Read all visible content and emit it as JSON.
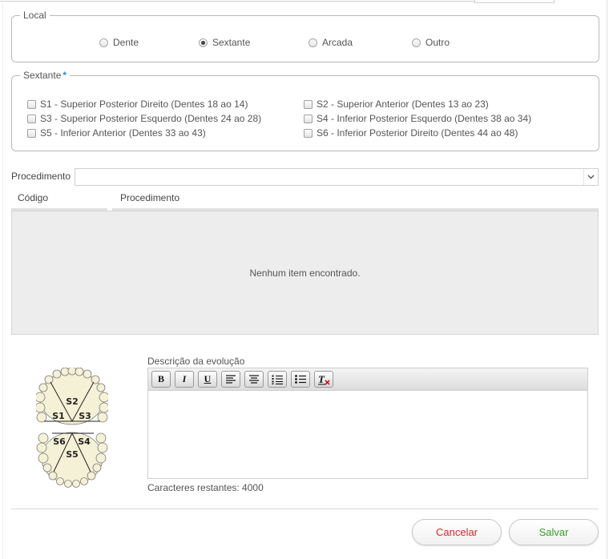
{
  "local": {
    "legend": "Local",
    "options": [
      {
        "label": "Dente",
        "selected": false
      },
      {
        "label": "Sextante",
        "selected": true
      },
      {
        "label": "Arcada",
        "selected": false
      },
      {
        "label": "Outro",
        "selected": false
      }
    ]
  },
  "sextante": {
    "legend": "Sextante",
    "required_mark": "*",
    "options": [
      {
        "label": "S1 - Superior Posterior Direito (Dentes 18 ao 14)",
        "checked": false
      },
      {
        "label": "S2 - Superior Anterior (Dentes 13 ao 23)",
        "checked": false
      },
      {
        "label": "S3 - Superior Posterior Esquerdo (Dentes 24 ao 28)",
        "checked": false
      },
      {
        "label": "S4 - Inferior Posterior Esquerdo (Dentes 38 ao 34)",
        "checked": false
      },
      {
        "label": "S5 - Inferior Anterior (Dentes 33 ao 43)",
        "checked": false
      },
      {
        "label": "S6 - Inferior Posterior Direito (Dentes 44 ao 48)",
        "checked": false
      }
    ]
  },
  "procedimento": {
    "label": "Procedimento",
    "selected_value": "",
    "icon": "chevron-down-icon"
  },
  "grid": {
    "columns": [
      "Código",
      "Procedimento"
    ],
    "empty_text": "Nenhum item encontrado."
  },
  "teeth_diagram": {
    "upper": [
      "S2",
      "S1",
      "S3"
    ],
    "lower": [
      "S6",
      "S4",
      "S5"
    ],
    "color": "#f5f1d6"
  },
  "description": {
    "label": "Descrição da evolução",
    "value": "",
    "toolbar": [
      "bold-icon",
      "italic-icon",
      "underline-icon",
      "align-left-icon",
      "align-center-icon",
      "ordered-list-icon",
      "unordered-list-icon",
      "clear-format-icon"
    ],
    "chars_remaining": "Caracteres restantes: 4000"
  },
  "buttons": {
    "cancel": "Cancelar",
    "save": "Salvar"
  },
  "colors": {
    "cancel": "#d02a2a",
    "save": "#3a9a2c",
    "required": "#2a8fd6"
  }
}
